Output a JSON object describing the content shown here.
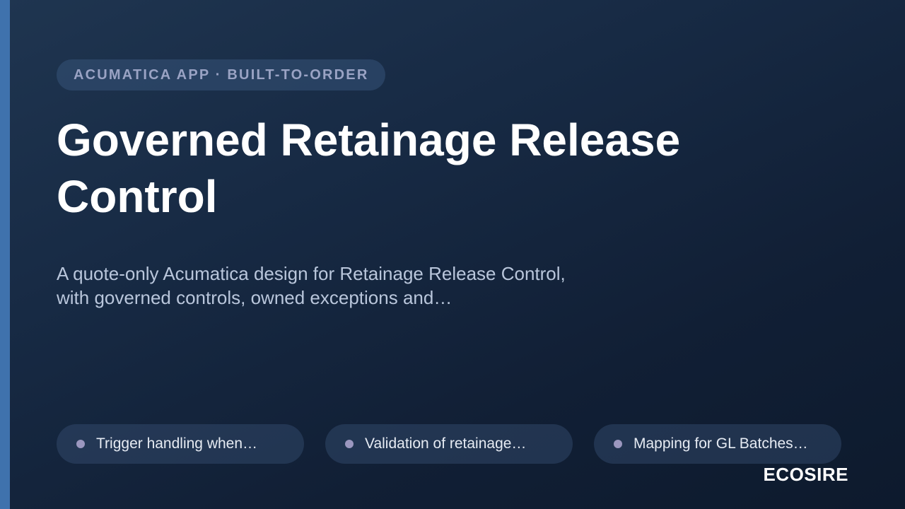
{
  "eyebrow": "ACUMATICA APP · BUILT-TO-ORDER",
  "title": "Governed Retainage Release Control",
  "subtitle_lines": [
    "A quote-only Acumatica design for Retainage Release Control,",
    "with governed controls, owned exceptions and…"
  ],
  "chips": [
    {
      "label": "Trigger handling when…"
    },
    {
      "label": "Validation of retainage…"
    },
    {
      "label": "Mapping for GL Batches…"
    }
  ],
  "brand": "ECOSIRE",
  "colors": {
    "accent_bar": "#3f72ad",
    "background_top": "#1f3550",
    "background_bottom": "#0d1a2d",
    "eyebrow_text": "#9aa3c4",
    "chip_dot": "#9b97bf"
  }
}
